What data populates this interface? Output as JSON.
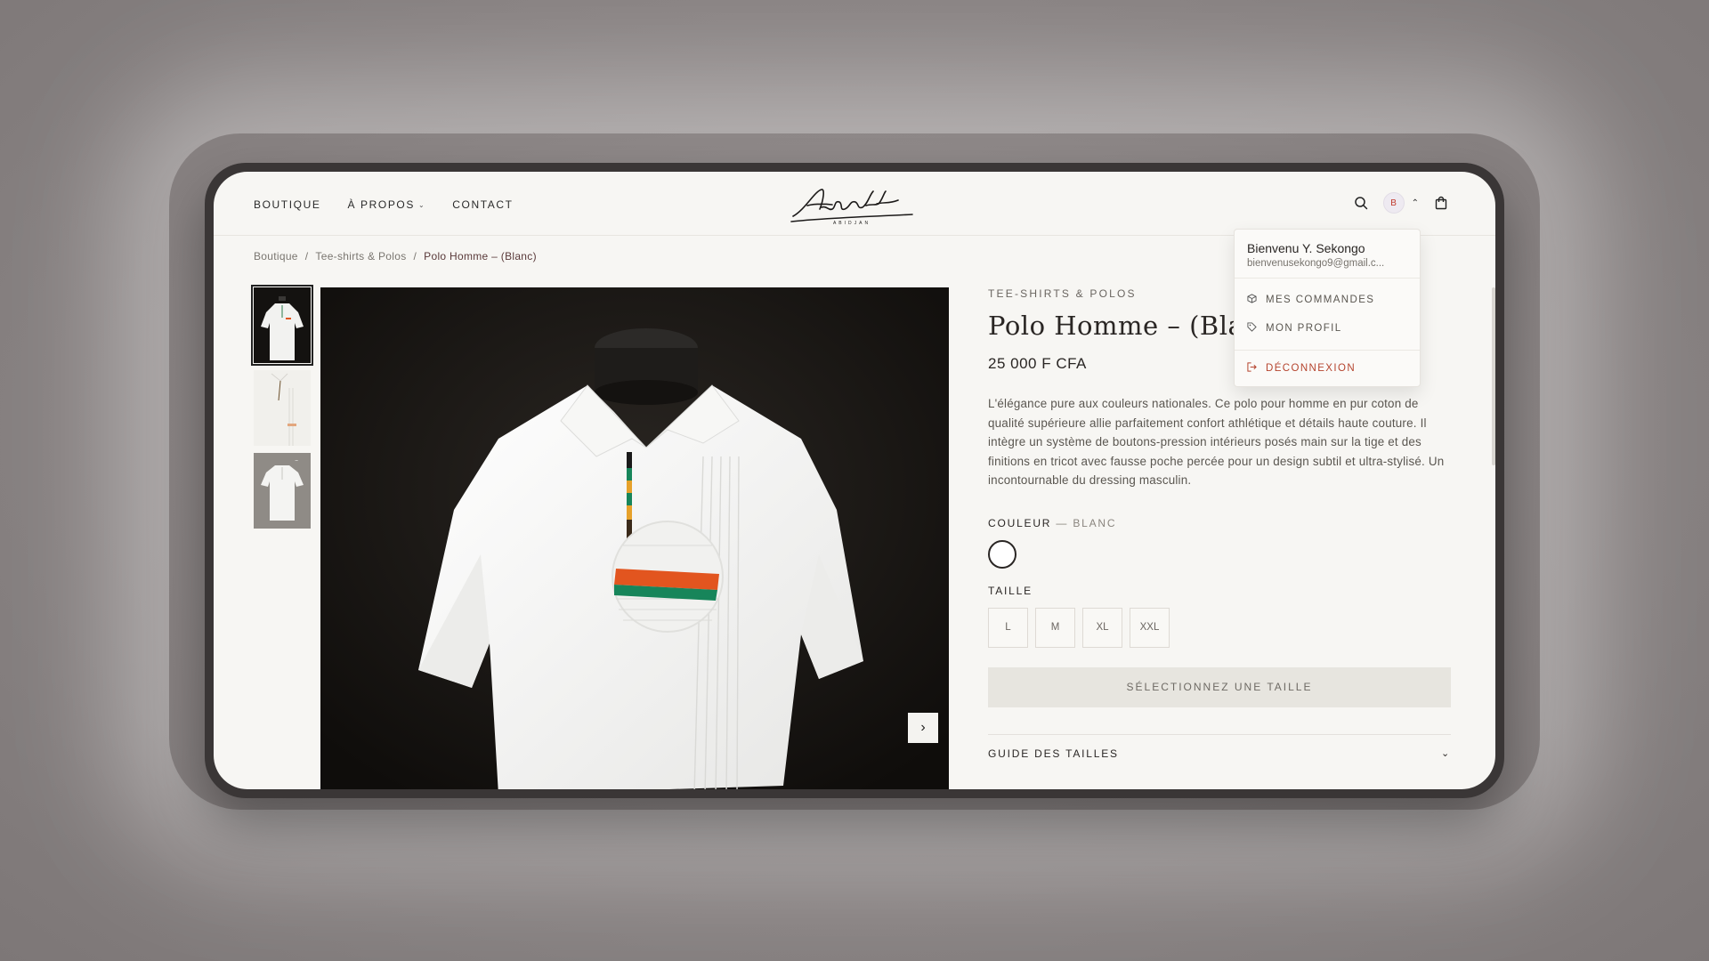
{
  "header": {
    "nav": [
      "BOUTIQUE",
      "À PROPOS",
      "CONTACT"
    ],
    "logo_text": "Arlett",
    "logo_sub": "ABIDJAN",
    "avatar_initial": "B"
  },
  "breadcrumb": {
    "items": [
      "Boutique",
      "Tee-shirts & Polos"
    ],
    "separator": "/",
    "current": "Polo Homme – (Blanc)"
  },
  "product": {
    "category": "TEE-SHIRTS & POLOS",
    "title": "Polo Homme – (Bla",
    "price": "25 000 F CFA",
    "description": "L'élégance pure aux couleurs nationales. Ce polo pour homme en pur coton de qualité supérieure allie parfaitement confort athlétique et détails haute couture. Il intègre un système de boutons-pression intérieurs posés main sur la tige et des finitions en tricot avec fausse poche percée pour un design subtil et ultra-stylisé. Un incontournable du dressing masculin.",
    "color_label": "COULEUR",
    "color_value": "— BLANC",
    "size_label": "TAILLE",
    "sizes": [
      "L",
      "M",
      "XL",
      "XXL"
    ],
    "cta": "SÉLECTIONNEZ UNE TAILLE",
    "guide": "GUIDE DES TAILLES"
  },
  "dropdown": {
    "name": "Bienvenu Y. Sekongo",
    "email": "bienvenusekongo9@gmail.c...",
    "items": [
      "MES COMMANDES",
      "MON PROFIL"
    ],
    "logout": "DÉCONNEXION"
  },
  "colors": {
    "accent": "#b5442e",
    "flag_orange": "#e2551f",
    "flag_green": "#17855a"
  }
}
